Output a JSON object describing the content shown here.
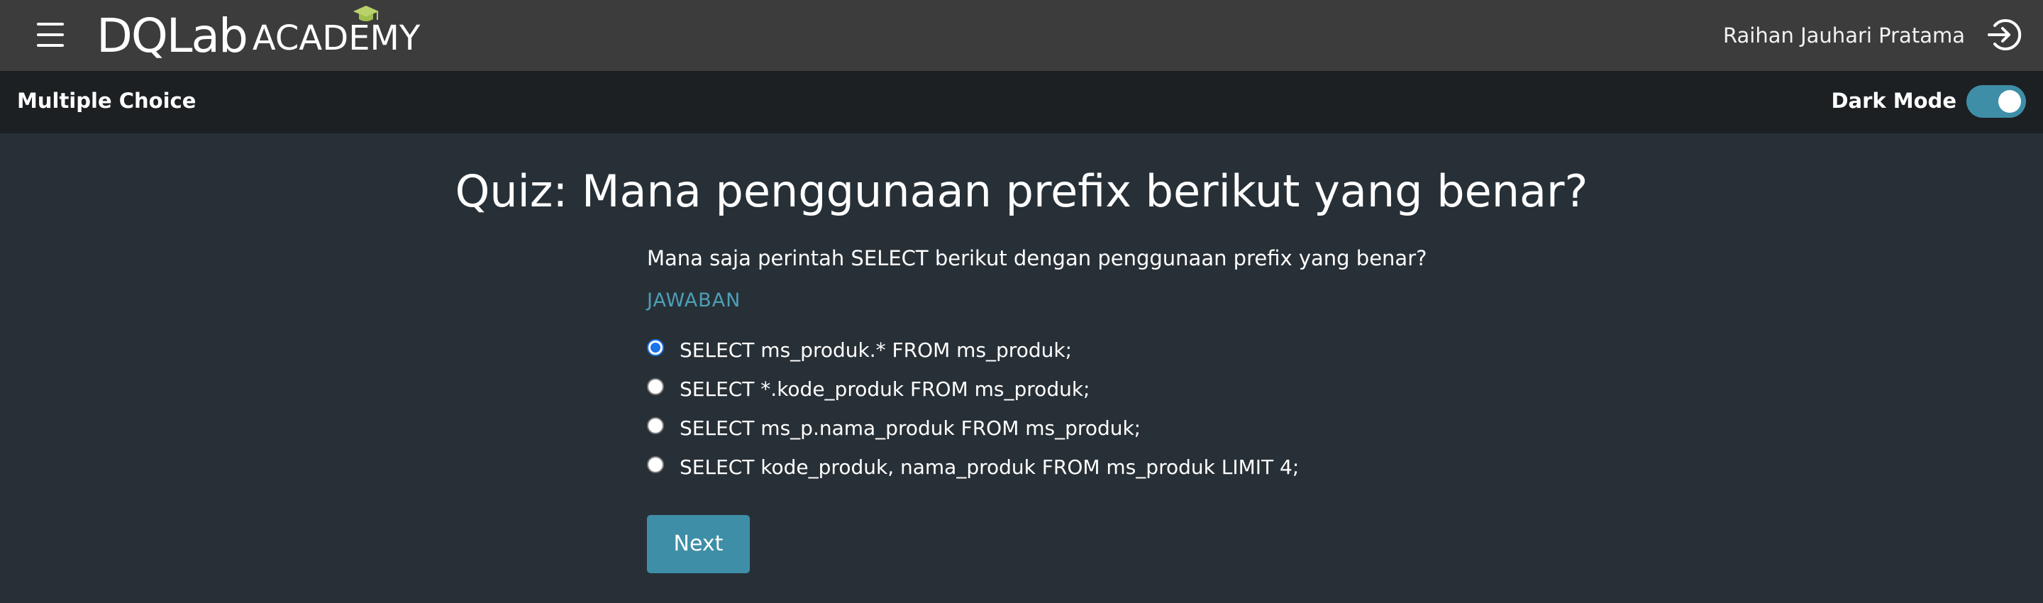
{
  "header": {
    "logo_mark": "DQLab",
    "logo_sub": "ACADEMY",
    "user_name": "Raihan Jauhari Pratama",
    "icons": {
      "menu": "hamburger-menu-icon",
      "logout": "logout-icon",
      "logo_accent": "graduation-cap-icon"
    }
  },
  "subheader": {
    "title": "Multiple Choice",
    "dark_mode_label": "Dark Mode",
    "dark_mode_on": true
  },
  "quiz": {
    "title": "Quiz: Mana penggunaan prefix berikut yang benar?",
    "question": "Mana saja perintah SELECT berikut dengan penggunaan prefix yang benar?",
    "answer_label": "JAWABAN",
    "options": [
      {
        "label": "SELECT ms_produk.* FROM ms_produk;",
        "selected": true
      },
      {
        "label": "SELECT *.kode_produk FROM ms_produk;",
        "selected": false
      },
      {
        "label": "SELECT ms_p.nama_produk FROM ms_produk;",
        "selected": false
      },
      {
        "label": "SELECT kode_produk, nama_produk FROM ms_produk LIMIT 4;",
        "selected": false
      }
    ],
    "next_label": "Next"
  },
  "colors": {
    "topbar": "#3c3c3c",
    "subbar": "#1c2023",
    "background": "#283037",
    "accent": "#3f8ea7",
    "answer_label": "#4c9fb6",
    "radio_selected": "#1a73e8",
    "logo_cap": "#b9d36a"
  }
}
